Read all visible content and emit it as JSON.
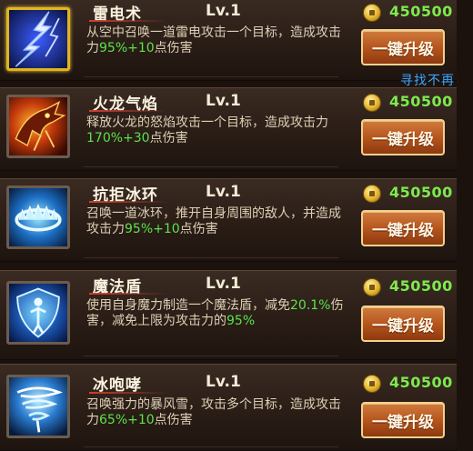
{
  "skills": [
    {
      "name": "雷电术",
      "level": "Lv.1",
      "desc_parts": [
        "从空中召唤一道雷电攻击一个目标，造成攻击力",
        "95%+10",
        "点伤害"
      ],
      "cost": "450500",
      "button_label": "一键升级",
      "icon": "lightning-icon",
      "selected": true
    },
    {
      "name": "火龙气焰",
      "level": "Lv.1",
      "desc_parts": [
        "释放火龙的怒焰攻击一个目标，造成攻击力",
        "170%+30",
        "点伤害"
      ],
      "cost": "450500",
      "button_label": "一键升级",
      "icon": "fire-dragon-icon",
      "selected": false
    },
    {
      "name": "抗拒冰环",
      "level": "Lv.1",
      "desc_parts": [
        "召唤一道冰环，推开自身周围的敌人，并造成攻击力",
        "95%+10",
        "点伤害"
      ],
      "cost": "450500",
      "button_label": "一键升级",
      "icon": "ice-ring-icon",
      "selected": false
    },
    {
      "name": "魔法盾",
      "level": "Lv.1",
      "desc_parts": [
        "使用自身魔力制造一个魔法盾，减免",
        "20.1%",
        "伤害，减免上限为攻击力的",
        "95%",
        ""
      ],
      "cost": "450500",
      "button_label": "一键升级",
      "icon": "magic-shield-icon",
      "selected": false
    },
    {
      "name": "冰咆哮",
      "level": "Lv.1",
      "desc_parts": [
        "召唤强力的暴风雪，攻击多个目标，造成攻击力",
        "65%+10",
        "点伤害"
      ],
      "cost": "450500",
      "button_label": "一键升级",
      "icon": "ice-storm-icon",
      "selected": false
    }
  ],
  "overlay_text": "寻找不再",
  "colors": {
    "cost": "#7eea4f",
    "highlight": "#5be24b",
    "button": "#b4521c",
    "overlay": "#3ba6ff"
  }
}
